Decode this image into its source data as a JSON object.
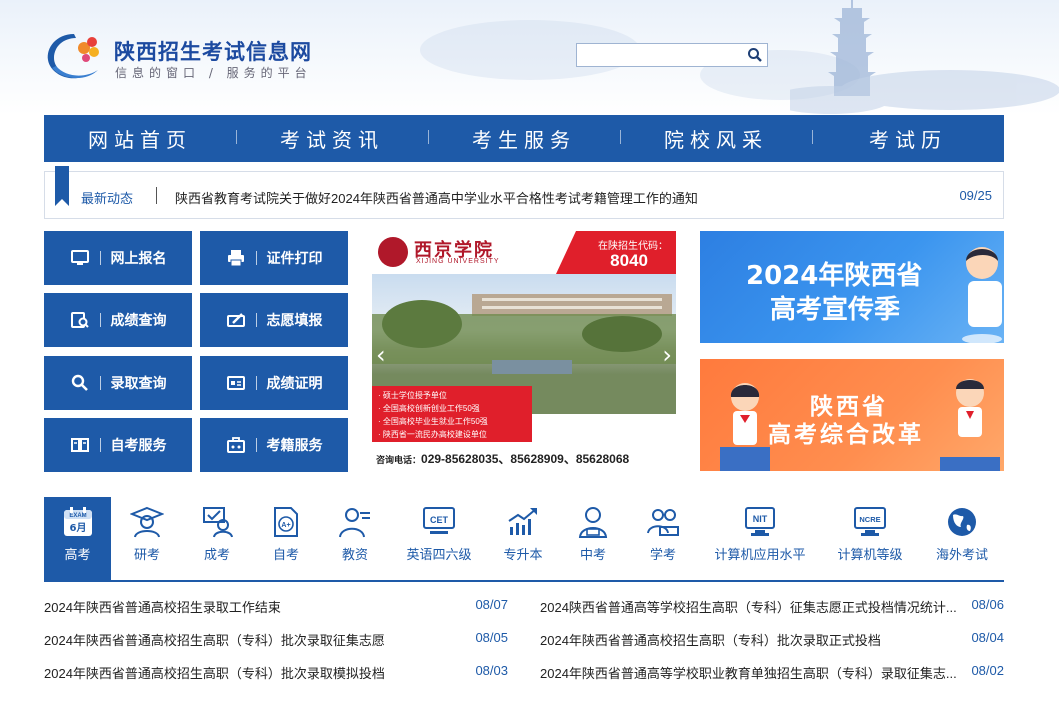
{
  "header": {
    "title": "陕西招生考试信息网",
    "slogan": "信息的窗口 / 服务的平台",
    "search_placeholder": "",
    "colors": {
      "brand_blue": "#1e5aa8",
      "accent_red": "#e01f2b",
      "accent_orange": "#ff7a3d"
    }
  },
  "nav": {
    "items": [
      "网站首页",
      "考试资讯",
      "考生服务",
      "院校风采",
      "考试历"
    ]
  },
  "ticker": {
    "label": "最新动态",
    "text": "陕西省教育考试院关于做好2024年陕西省普通高中学业水平合格性考试考籍管理工作的通知",
    "date": "09/25"
  },
  "services": [
    {
      "label": "网上报名",
      "icon": "monitor-icon"
    },
    {
      "label": "证件打印",
      "icon": "printer-icon"
    },
    {
      "label": "成绩查询",
      "icon": "score-search-icon"
    },
    {
      "label": "志愿填报",
      "icon": "form-fill-icon"
    },
    {
      "label": "录取查询",
      "icon": "search-icon"
    },
    {
      "label": "成绩证明",
      "icon": "certificate-icon"
    },
    {
      "label": "自考服务",
      "icon": "book-icon"
    },
    {
      "label": "考籍服务",
      "icon": "briefcase-icon"
    }
  ],
  "carousel": {
    "school_name": "西京学院",
    "school_en": "XIJING UNIVERSITY",
    "code_label": "在陕招生代码：",
    "code": "8040",
    "highlights": [
      "· 硕士学位授予单位",
      "· 全国高校创新创业工作50强",
      "· 全国高校毕业生就业工作50强",
      "· 陕西省一流民办高校建设单位"
    ],
    "phone_label": "咨询电话：",
    "phone": "029-85628035、85628909、85628068"
  },
  "banners": [
    {
      "line1": "2024年陕西省",
      "line2": "高考宣传季"
    },
    {
      "line1": "陕西省",
      "line2": "高考综合改革"
    }
  ],
  "categories": [
    {
      "label": "高考",
      "icon": "calendar-exam-icon",
      "active": true,
      "badge_top": "EXAM",
      "badge_bottom": "6月"
    },
    {
      "label": "研考",
      "icon": "graduate-icon"
    },
    {
      "label": "成考",
      "icon": "adult-exam-icon"
    },
    {
      "label": "自考",
      "icon": "self-study-icon",
      "badge_top": "A+"
    },
    {
      "label": "教资",
      "icon": "teacher-icon"
    },
    {
      "label": "英语四六级",
      "icon": "cet-icon",
      "badge_top": "CET"
    },
    {
      "label": "专升本",
      "icon": "growth-chart-icon"
    },
    {
      "label": "中考",
      "icon": "student-icon"
    },
    {
      "label": "学考",
      "icon": "study-group-icon"
    },
    {
      "label": "计算机应用水平",
      "icon": "nit-icon",
      "badge_top": "NIT"
    },
    {
      "label": "计算机等级",
      "icon": "ncre-icon",
      "badge_top": "NCRE"
    },
    {
      "label": "海外考试",
      "icon": "globe-icon"
    }
  ],
  "news": [
    {
      "title": "2024年陕西省普通高校招生录取工作结束",
      "date": "08/07"
    },
    {
      "title": "2024陕西省普通高等学校招生高职（专科）征集志愿正式投档情况统计...",
      "date": "08/06"
    },
    {
      "title": "2024年陕西省普通高校招生高职（专科）批次录取征集志愿",
      "date": "08/05"
    },
    {
      "title": "2024年陕西省普通高校招生高职（专科）批次录取正式投档",
      "date": "08/04"
    },
    {
      "title": "2024年陕西省普通高校招生高职（专科）批次录取模拟投档",
      "date": "08/03"
    },
    {
      "title": "2024年陕西省普通高等学校职业教育单独招生高职（专科）录取征集志...",
      "date": "08/02"
    }
  ]
}
